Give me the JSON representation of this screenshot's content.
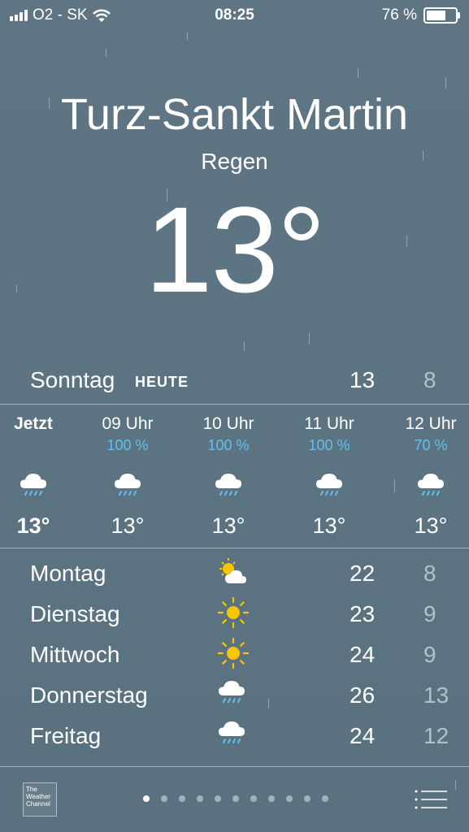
{
  "status_bar": {
    "carrier": "O2 - SK",
    "time": "08:25",
    "battery": "76 %",
    "battery_level": 0.76
  },
  "location": {
    "city": "Turz-Sankt Martin",
    "condition": "Regen",
    "temperature": "13°"
  },
  "today": {
    "day": "Sonntag",
    "label": "HEUTE",
    "high": "13",
    "low": "8"
  },
  "hourly": [
    {
      "time": "Jetzt",
      "precip": "",
      "icon": "rain-cloud-icon",
      "temp": "13°"
    },
    {
      "time": "09 Uhr",
      "precip": "100 %",
      "icon": "rain-cloud-icon",
      "temp": "13°"
    },
    {
      "time": "10 Uhr",
      "precip": "100 %",
      "icon": "rain-cloud-icon",
      "temp": "13°"
    },
    {
      "time": "11 Uhr",
      "precip": "100 %",
      "icon": "rain-cloud-icon",
      "temp": "13°"
    },
    {
      "time": "12 Uhr",
      "precip": "70 %",
      "icon": "rain-cloud-icon",
      "temp": "13°"
    }
  ],
  "daily": [
    {
      "day": "Montag",
      "icon": "partly-cloudy-icon",
      "high": "22",
      "low": "8"
    },
    {
      "day": "Dienstag",
      "icon": "sun-icon",
      "high": "23",
      "low": "9"
    },
    {
      "day": "Mittwoch",
      "icon": "sun-icon",
      "high": "24",
      "low": "9"
    },
    {
      "day": "Donnerstag",
      "icon": "rain-cloud-icon",
      "high": "26",
      "low": "13"
    },
    {
      "day": "Freitag",
      "icon": "rain-cloud-icon",
      "high": "24",
      "low": "12"
    }
  ],
  "footer": {
    "provider_logo": "The Weather Channel",
    "page_count": 11,
    "active_page": 0
  },
  "colors": {
    "background": "#5c7482",
    "precip_blue": "#5fc2f0",
    "sun_yellow": "#f7c600"
  }
}
